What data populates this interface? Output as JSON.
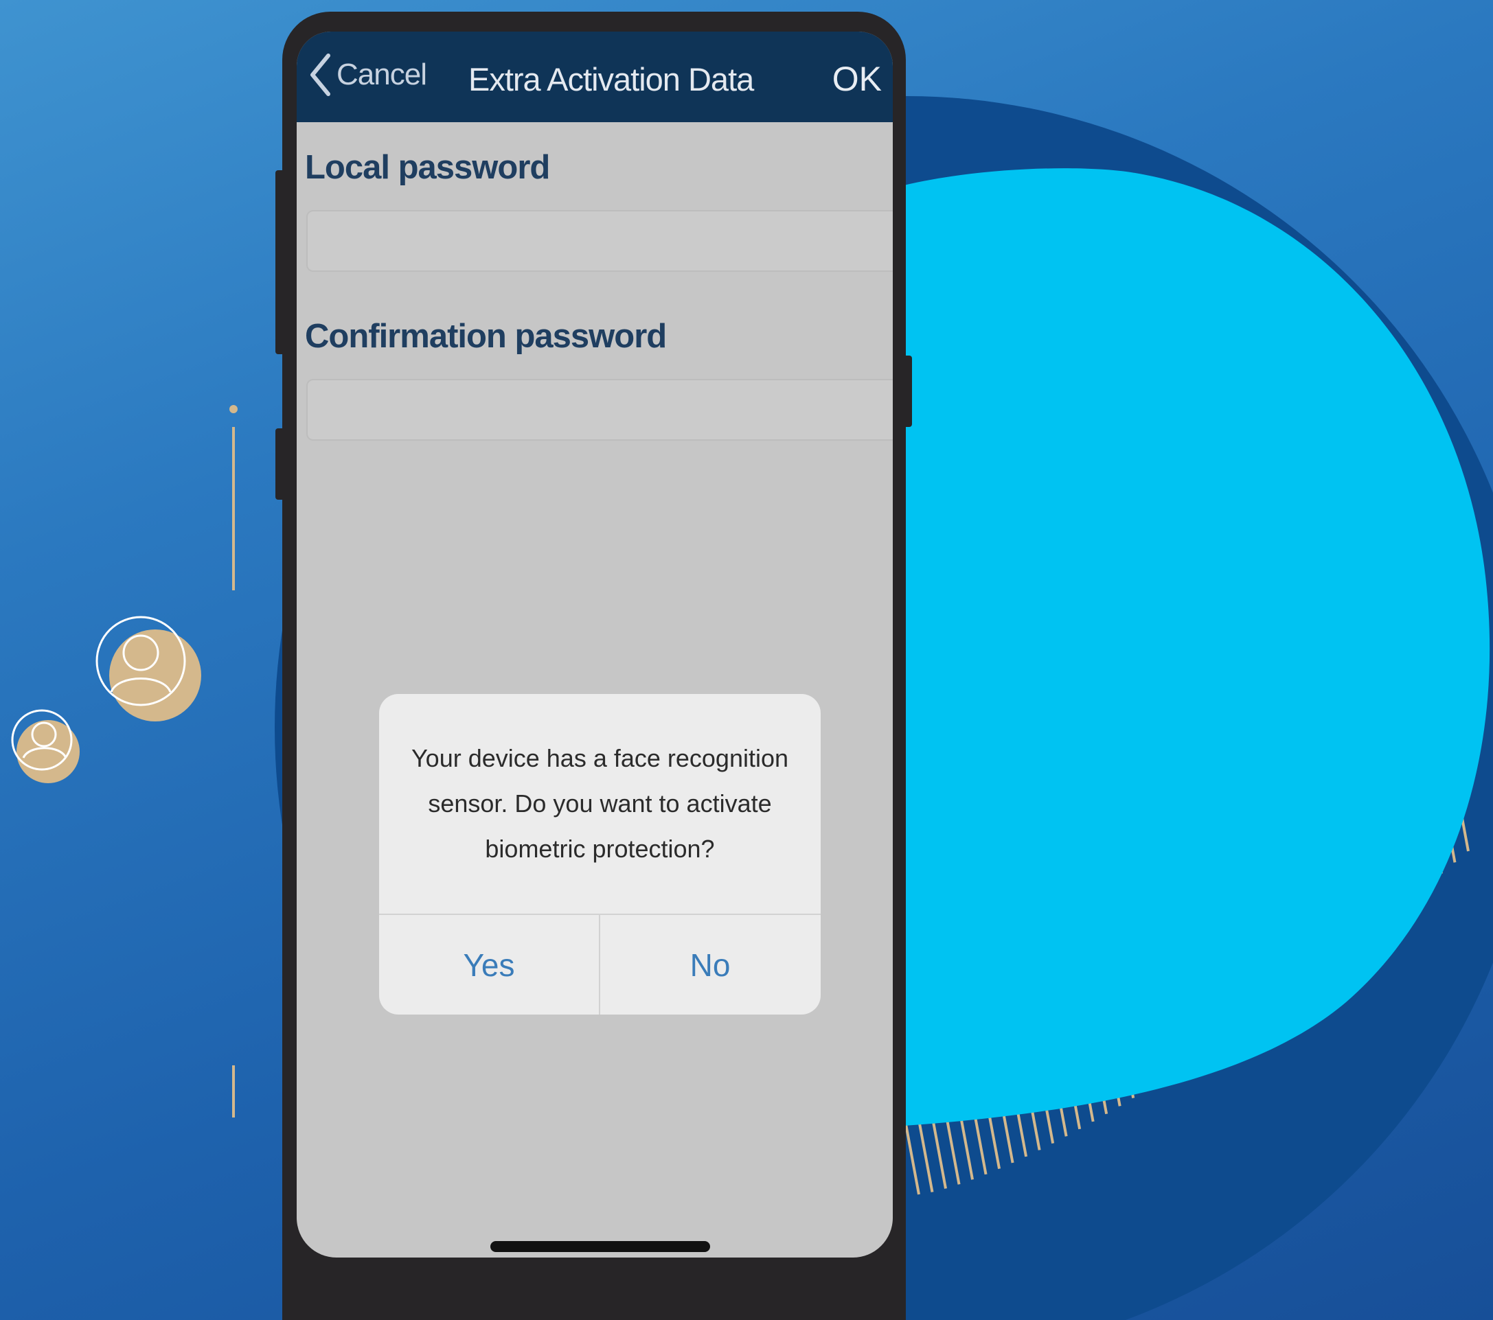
{
  "colors": {
    "background_blue": "#2b79c0",
    "circle_cyan": "#00c3f2",
    "circle_shadow": "#0e4b8e",
    "accent_gold": "#d4b88c",
    "navbar_bg": "#0f3457",
    "screen_bg": "#c6c6c6",
    "dialog_bg": "#ececec",
    "dialog_button_text": "#3a7cb9"
  },
  "icons": {
    "back": "chevron-left-icon",
    "avatar_large": "user-avatar-icon",
    "avatar_small": "user-avatar-icon"
  },
  "navbar": {
    "cancel_label": "Cancel",
    "title": "Extra Activation Data",
    "ok_label": "OK"
  },
  "form": {
    "local_password_label": "Local password",
    "local_password_value": "",
    "confirmation_password_label": "Confirmation password",
    "confirmation_password_value": ""
  },
  "dialog": {
    "message_line1": "Your device has a face recognition",
    "message_line2": "sensor. Do you want to activate",
    "message_line3": "biometric protection?",
    "yes_label": "Yes",
    "no_label": "No"
  }
}
